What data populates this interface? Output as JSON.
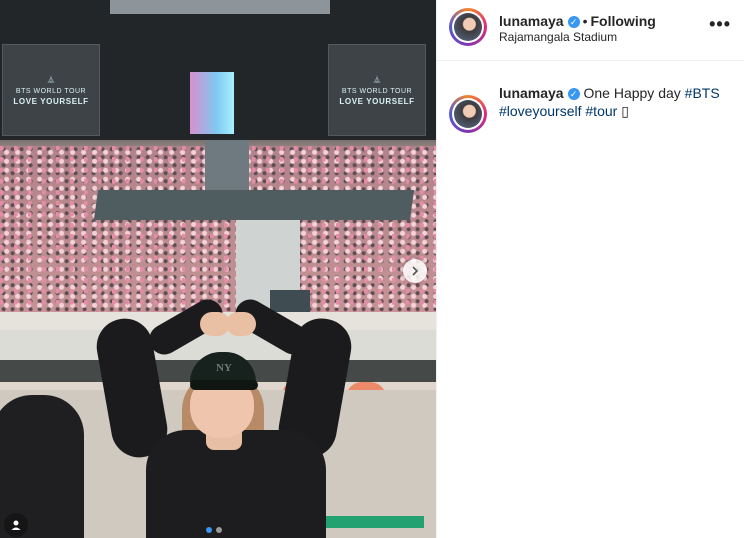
{
  "post": {
    "username": "lunamaya",
    "verified_mark": "✓",
    "separator": "•",
    "follow_state": "Following",
    "location": "Rajamangala Stadium",
    "more_options": "•••",
    "caption_text": "One Happy day",
    "hashtags": [
      "#BTS",
      "#loveyourself",
      "#tour"
    ],
    "caption_tail": "▯"
  },
  "photo": {
    "screen_left": {
      "line1": "BTS WORLD TOUR",
      "line2": "LOVE YOURSELF"
    },
    "screen_right": {
      "line1": "BTS WORLD TOUR",
      "line2": "LOVE YOURSELF"
    },
    "cap_logo": "NY",
    "next_icon": "chevron-right-icon",
    "user_icon": "user-tag-icon",
    "carousel_count": 2,
    "carousel_active": 0
  },
  "colors": {
    "link": "#00376b",
    "accent": "#3897f0",
    "text": "#262626"
  }
}
